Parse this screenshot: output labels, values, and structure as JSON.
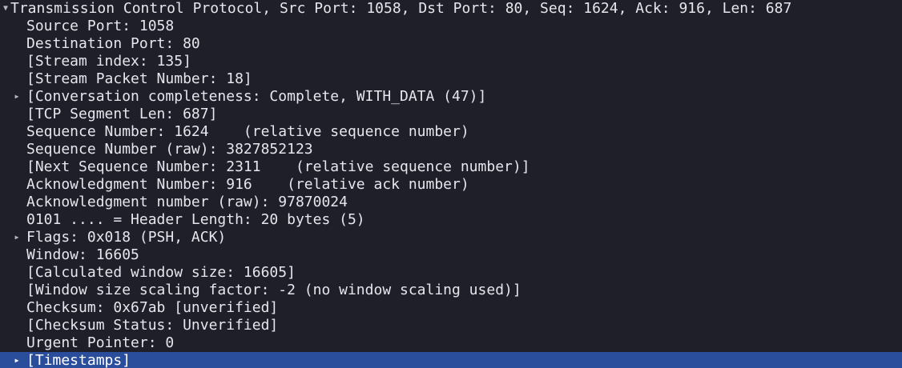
{
  "header": {
    "label": "Transmission Control Protocol, Src Port: 1058, Dst Port: 80, Seq: 1624, Ack: 916, Len: 687",
    "expander": "expanded"
  },
  "fields": [
    {
      "label": "Source Port: 1058",
      "expander": "none"
    },
    {
      "label": "Destination Port: 80",
      "expander": "none"
    },
    {
      "label": "[Stream index: 135]",
      "expander": "none"
    },
    {
      "label": "[Stream Packet Number: 18]",
      "expander": "none"
    },
    {
      "label": "[Conversation completeness: Complete, WITH_DATA (47)]",
      "expander": "collapsed"
    },
    {
      "label": "[TCP Segment Len: 687]",
      "expander": "none"
    },
    {
      "label": "Sequence Number: 1624    (relative sequence number)",
      "expander": "none"
    },
    {
      "label": "Sequence Number (raw): 3827852123",
      "expander": "none"
    },
    {
      "label": "[Next Sequence Number: 2311    (relative sequence number)]",
      "expander": "none"
    },
    {
      "label": "Acknowledgment Number: 916    (relative ack number)",
      "expander": "none"
    },
    {
      "label": "Acknowledgment number (raw): 97870024",
      "expander": "none"
    },
    {
      "label": "0101 .... = Header Length: 20 bytes (5)",
      "expander": "none"
    },
    {
      "label": "Flags: 0x018 (PSH, ACK)",
      "expander": "collapsed"
    },
    {
      "label": "Window: 16605",
      "expander": "none"
    },
    {
      "label": "[Calculated window size: 16605]",
      "expander": "none"
    },
    {
      "label": "[Window size scaling factor: -2 (no window scaling used)]",
      "expander": "none"
    },
    {
      "label": "Checksum: 0x67ab [unverified]",
      "expander": "none"
    },
    {
      "label": "[Checksum Status: Unverified]",
      "expander": "none"
    },
    {
      "label": "Urgent Pointer: 0",
      "expander": "none"
    },
    {
      "label": "[Timestamps]",
      "expander": "collapsed",
      "selected": true
    }
  ],
  "colors": {
    "background": "#1f1f2a",
    "text": "#e6e6ec",
    "selection": "#2a4d9c"
  },
  "icons": {
    "expanded": "chevron-down-icon",
    "collapsed": "chevron-right-icon"
  }
}
